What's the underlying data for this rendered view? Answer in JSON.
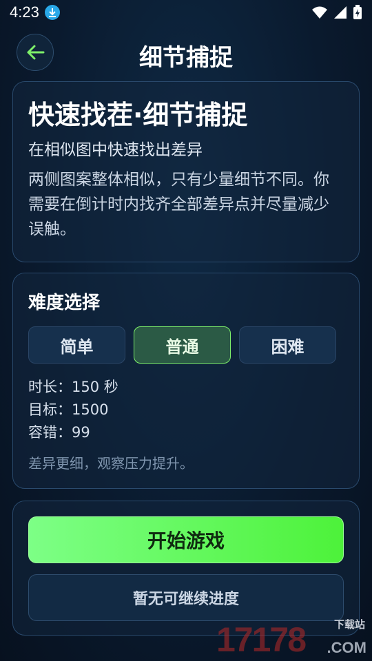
{
  "status_bar": {
    "time": "4:23"
  },
  "header": {
    "title": "细节捕捉"
  },
  "intro": {
    "title": "快速找茬·细节捕捉",
    "subtitle": "在相似图中快速找出差异",
    "description": "两侧图案整体相似，只有少量细节不同。你需要在倒计时内找齐全部差异点并尽量减少误触。"
  },
  "difficulty": {
    "title": "难度选择",
    "options": [
      {
        "label": "简单",
        "selected": false
      },
      {
        "label": "普通",
        "selected": true
      },
      {
        "label": "困难",
        "selected": false
      }
    ],
    "duration": "时长：150 秒",
    "target": "目标：1500",
    "tolerance": "容错：99",
    "note": "差异更细，观察压力提升。"
  },
  "actions": {
    "start_label": "开始游戏",
    "continue_label": "暂无可继续进度"
  },
  "watermark": {
    "number": "17178",
    "tag": "下载站",
    "domain": ".COM"
  },
  "colors": {
    "accent_green": "#4df23a",
    "selected_border": "#7ef06a",
    "background": "#0a1a2e"
  }
}
